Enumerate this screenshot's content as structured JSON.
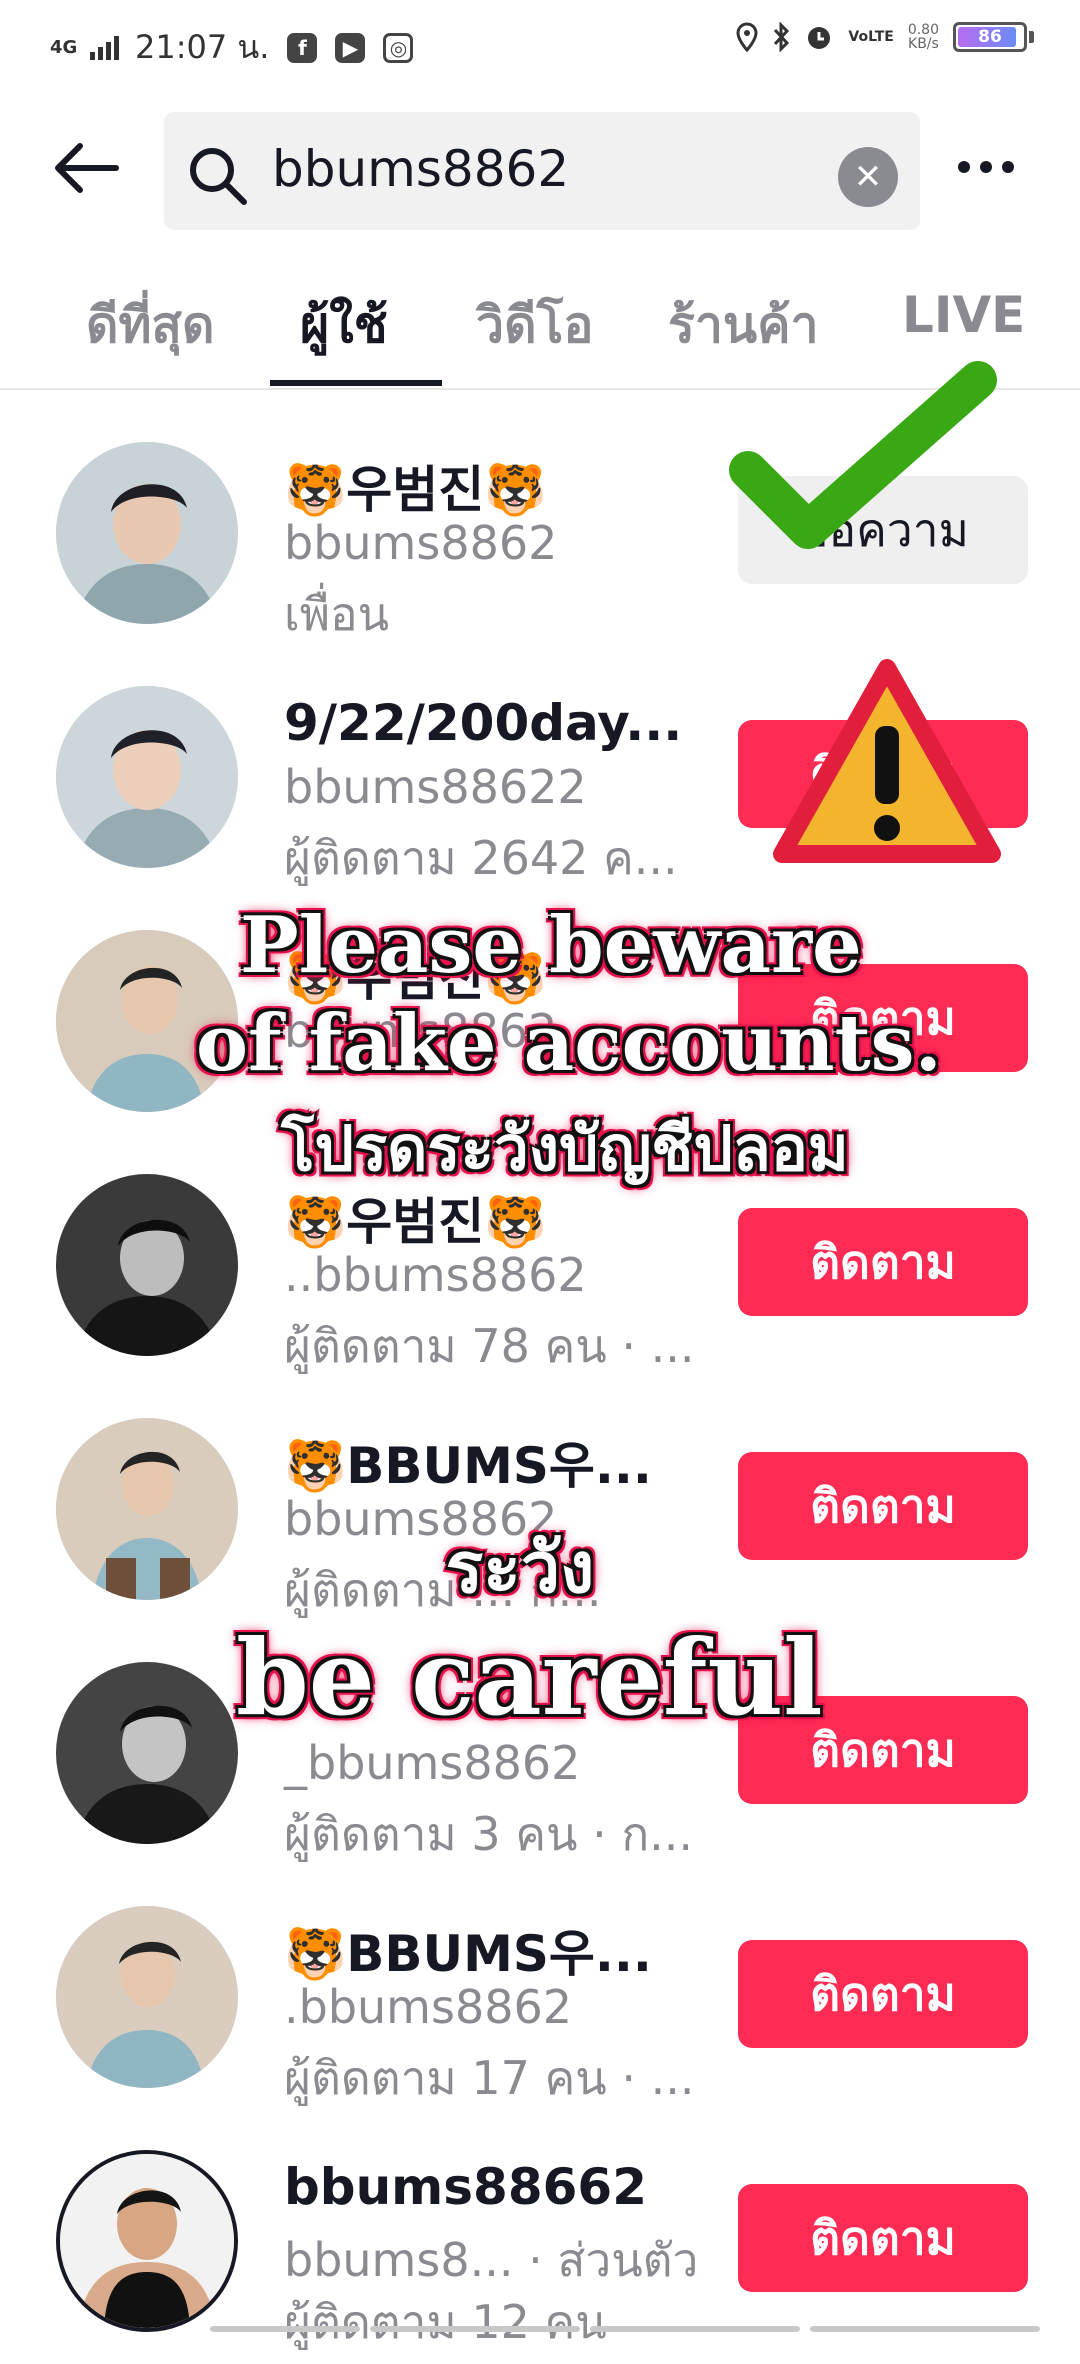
{
  "status_bar": {
    "network": "4G",
    "time": "21:07 น.",
    "volte": "VoLTE",
    "speed_value": "0.80",
    "speed_unit": "KB/s",
    "battery": "86",
    "battery_level": 0.86,
    "notification_icons": [
      "facebook-icon",
      "youtube-icon",
      "instagram-icon"
    ],
    "system_icons": [
      "location-icon",
      "bluetooth-icon",
      "alarm-icon"
    ]
  },
  "search": {
    "query": "bbums8862"
  },
  "tabs": [
    {
      "label": "ดีที่สุด",
      "active": false
    },
    {
      "label": "ผู้ใช้",
      "active": true
    },
    {
      "label": "วิดีโอ",
      "active": false
    },
    {
      "label": "ร้านค้า",
      "active": false
    },
    {
      "label": "LIVE",
      "active": false
    }
  ],
  "users": [
    {
      "name": "🐯우범진🐯",
      "handle": "bbums8862",
      "info": "เพื่อน",
      "action": "ข้อความ"
    },
    {
      "name": "9/22/200day...",
      "handle": "bbums88622",
      "info": "ผู้ติดตาม 2642 ค...",
      "action": "ติดตาม"
    },
    {
      "name": "🐯우범진🐯",
      "handle": "bbums8862...",
      "info": "",
      "action": "ติดตาม"
    },
    {
      "name": "🐯우범진🐯",
      "handle": "..bbums8862",
      "info": "ผู้ติดตาม 78 คน · ...",
      "action": "ติดตาม"
    },
    {
      "name": "🐯BBUMS우...",
      "handle": "bbums8862",
      "info": "ผู้ติดตาม ... ก...",
      "action": "ติดตาม"
    },
    {
      "name": "",
      "handle": "_bbums8862",
      "info": "ผู้ติดตาม 3 คน · ก...",
      "action": "ติดตาม"
    },
    {
      "name": "🐯BBUMS우...",
      "handle": ".bbums8862",
      "info": "ผู้ติดตาม 17 คน · ...",
      "action": "ติดตาม"
    },
    {
      "name": "bbums88662",
      "handle": "bbums8... · ส่วนตัว",
      "info": "ผู้ติดตาม 12 คน",
      "action": "ติดตาม"
    }
  ],
  "overlays": {
    "warning_line1": "Please beware",
    "warning_line2": "of fake accounts.",
    "warning_line3": "โปรดระวังบัญชีปลอม",
    "careful_line1": "ระวัง",
    "careful_line2": "be careful",
    "check_color": "#3aa815",
    "warning_color": "#f2b52d",
    "warning_border": "#e11f3c",
    "accent_color": "#fe2c55"
  }
}
